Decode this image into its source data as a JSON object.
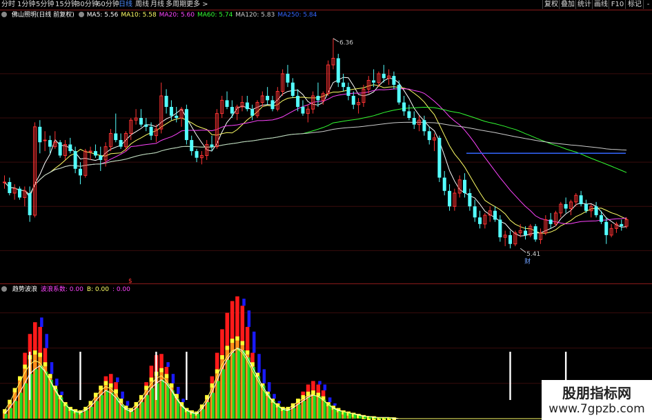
{
  "toolbar": {
    "periods": [
      {
        "label": "分时",
        "active": false
      },
      {
        "label": "1分钟",
        "active": false
      },
      {
        "label": "5分钟",
        "active": false
      },
      {
        "label": "15分钟",
        "active": false
      },
      {
        "label": "30分钟",
        "active": false
      },
      {
        "label": "60分钟",
        "active": false
      },
      {
        "label": "日线",
        "active": true
      },
      {
        "label": "周线",
        "active": false
      },
      {
        "label": "月线",
        "active": false
      },
      {
        "label": "多周期",
        "active": false
      },
      {
        "label": "更多 >",
        "active": false
      }
    ],
    "right_buttons": [
      "复权",
      "叠加",
      "统计",
      "画线",
      "F10",
      "标记",
      "-"
    ]
  },
  "main_legend": {
    "title": "佛山照明(日线 前复权)",
    "items": [
      {
        "label": "MA5: 5.56",
        "color": "#ffffff"
      },
      {
        "label": "MA10: 5.58",
        "color": "#ffff66"
      },
      {
        "label": "MA20: 5.60",
        "color": "#ff44ff"
      },
      {
        "label": "MA60: 5.74",
        "color": "#33ff33"
      },
      {
        "label": "MA120: 5.83",
        "color": "#cccccc"
      },
      {
        "label": "MA250: 5.84",
        "color": "#3366ff"
      }
    ]
  },
  "indicator_legend": {
    "title": "趋势波浪",
    "items": [
      {
        "label": "波浪系数: 0.00",
        "color": "#ff44ff"
      },
      {
        "label": "B: 0.00",
        "color": "#ffff66"
      },
      {
        "label": ": 0.00",
        "color": "#ff44ff"
      }
    ]
  },
  "annotations": {
    "high_label": "6.36",
    "low_label": "5.41",
    "event_mark_main": "财",
    "event_mark_bottom": "$"
  },
  "watermark": {
    "title": "股朋指标网",
    "url": "www.7gpzb.com"
  },
  "colors": {
    "up": "#ff3333",
    "down": "#54ffff",
    "separator": "#8b1a1a",
    "grid": "#3a0c0c"
  },
  "chart_data": [
    {
      "type": "candlestick",
      "title": "佛山照明(日线 前复权)",
      "ylim": [
        5.27,
        6.44
      ],
      "annotations": [
        {
          "label": "6.36",
          "value": 6.36
        },
        {
          "label": "5.41",
          "value": 5.41
        }
      ],
      "candles": [
        [
          5.71,
          5.74,
          5.68,
          5.71
        ],
        [
          5.71,
          5.73,
          5.65,
          5.66
        ],
        [
          5.66,
          5.7,
          5.63,
          5.68
        ],
        [
          5.68,
          5.69,
          5.63,
          5.64
        ],
        [
          5.64,
          5.69,
          5.6,
          5.67
        ],
        [
          5.66,
          5.69,
          5.53,
          5.56
        ],
        [
          5.56,
          5.98,
          5.55,
          5.96
        ],
        [
          5.96,
          5.99,
          5.84,
          5.89
        ],
        [
          5.9,
          5.94,
          5.85,
          5.9
        ],
        [
          5.9,
          5.92,
          5.84,
          5.87
        ],
        [
          5.87,
          5.94,
          5.86,
          5.89
        ],
        [
          5.89,
          5.9,
          5.82,
          5.83
        ],
        [
          5.83,
          5.9,
          5.81,
          5.88
        ],
        [
          5.88,
          5.91,
          5.84,
          5.85
        ],
        [
          5.85,
          5.87,
          5.75,
          5.77
        ],
        [
          5.77,
          5.8,
          5.7,
          5.74
        ],
        [
          5.74,
          5.86,
          5.73,
          5.85
        ],
        [
          5.85,
          5.87,
          5.81,
          5.85
        ],
        [
          5.85,
          5.88,
          5.82,
          5.83
        ],
        [
          5.83,
          5.87,
          5.76,
          5.81
        ],
        [
          5.81,
          5.89,
          5.78,
          5.87
        ],
        [
          5.87,
          5.95,
          5.85,
          5.93
        ],
        [
          5.93,
          6.02,
          5.89,
          5.9
        ],
        [
          5.9,
          5.93,
          5.86,
          5.87
        ],
        [
          5.87,
          5.94,
          5.85,
          5.93
        ],
        [
          5.93,
          6.0,
          5.9,
          5.99
        ],
        [
          5.99,
          6.04,
          5.97,
          6.0
        ],
        [
          6.0,
          6.04,
          5.96,
          5.97
        ],
        [
          5.97,
          6.0,
          5.94,
          5.96
        ],
        [
          5.96,
          5.98,
          5.9,
          5.92
        ],
        [
          5.92,
          5.97,
          5.89,
          5.95
        ],
        [
          5.95,
          6.16,
          5.93,
          6.1
        ],
        [
          6.1,
          6.13,
          6.02,
          6.05
        ],
        [
          6.05,
          6.08,
          5.99,
          6.01
        ],
        [
          6.01,
          6.05,
          5.98,
          6.0
        ],
        [
          6.0,
          6.05,
          5.96,
          6.04
        ],
        [
          6.04,
          6.06,
          5.88,
          5.9
        ],
        [
          5.9,
          5.92,
          5.83,
          5.85
        ],
        [
          5.85,
          5.86,
          5.8,
          5.82
        ],
        [
          5.82,
          5.85,
          5.79,
          5.83
        ],
        [
          5.83,
          5.9,
          5.81,
          5.88
        ],
        [
          5.88,
          5.92,
          5.85,
          5.87
        ],
        [
          5.87,
          6.04,
          5.86,
          6.02
        ],
        [
          6.02,
          6.1,
          6.0,
          6.08
        ],
        [
          6.08,
          6.12,
          6.04,
          6.05
        ],
        [
          6.05,
          6.08,
          6.0,
          6.02
        ],
        [
          6.02,
          6.06,
          5.99,
          6.05
        ],
        [
          6.05,
          6.1,
          6.03,
          6.07
        ],
        [
          6.07,
          6.1,
          6.03,
          6.04
        ],
        [
          6.04,
          6.06,
          5.99,
          6.01
        ],
        [
          6.01,
          6.08,
          6.0,
          6.07
        ],
        [
          6.07,
          6.12,
          6.05,
          6.1
        ],
        [
          6.1,
          6.14,
          6.06,
          6.08
        ],
        [
          6.08,
          6.1,
          6.03,
          6.04
        ],
        [
          6.04,
          6.14,
          6.03,
          6.12
        ],
        [
          6.12,
          6.22,
          6.1,
          6.2
        ],
        [
          6.2,
          6.24,
          6.14,
          6.16
        ],
        [
          6.16,
          6.18,
          6.09,
          6.1
        ],
        [
          6.1,
          6.13,
          6.03,
          6.05
        ],
        [
          6.05,
          6.08,
          6.01,
          6.02
        ],
        [
          6.02,
          6.06,
          5.98,
          6.04
        ],
        [
          6.04,
          6.12,
          6.02,
          6.1
        ],
        [
          6.1,
          6.16,
          6.05,
          6.08
        ],
        [
          6.08,
          6.12,
          6.06,
          6.11
        ],
        [
          6.11,
          6.26,
          6.1,
          6.24
        ],
        [
          6.24,
          6.36,
          6.22,
          6.27
        ],
        [
          6.27,
          6.29,
          6.14,
          6.16
        ],
        [
          6.16,
          6.2,
          6.12,
          6.14
        ],
        [
          6.14,
          6.16,
          6.08,
          6.1
        ],
        [
          6.1,
          6.12,
          6.04,
          6.06
        ],
        [
          6.06,
          6.09,
          6.02,
          6.07
        ],
        [
          6.07,
          6.15,
          6.05,
          6.13
        ],
        [
          6.13,
          6.19,
          6.11,
          6.17
        ],
        [
          6.17,
          6.22,
          6.14,
          6.16
        ],
        [
          6.16,
          6.21,
          6.14,
          6.2
        ],
        [
          6.2,
          6.24,
          6.16,
          6.18
        ],
        [
          6.18,
          6.22,
          6.15,
          6.19
        ],
        [
          6.19,
          6.21,
          6.13,
          6.15
        ],
        [
          6.15,
          6.17,
          6.06,
          6.07
        ],
        [
          6.07,
          6.1,
          6.01,
          6.03
        ],
        [
          6.03,
          6.06,
          5.99,
          6.0
        ],
        [
          6.0,
          6.03,
          5.95,
          5.97
        ],
        [
          5.97,
          6.01,
          5.94,
          5.99
        ],
        [
          5.99,
          6.01,
          5.92,
          5.94
        ],
        [
          5.94,
          5.96,
          5.88,
          5.9
        ],
        [
          5.9,
          5.93,
          5.85,
          5.91
        ],
        [
          5.91,
          5.92,
          5.71,
          5.73
        ],
        [
          5.73,
          5.76,
          5.65,
          5.67
        ],
        [
          5.67,
          5.7,
          5.58,
          5.6
        ],
        [
          5.6,
          5.68,
          5.58,
          5.66
        ],
        [
          5.66,
          5.74,
          5.64,
          5.72
        ],
        [
          5.72,
          5.75,
          5.64,
          5.66
        ],
        [
          5.66,
          5.68,
          5.58,
          5.6
        ],
        [
          5.6,
          5.63,
          5.53,
          5.55
        ],
        [
          5.55,
          5.58,
          5.5,
          5.52
        ],
        [
          5.52,
          5.57,
          5.5,
          5.56
        ],
        [
          5.56,
          5.6,
          5.53,
          5.58
        ],
        [
          5.58,
          5.6,
          5.53,
          5.54
        ],
        [
          5.54,
          5.56,
          5.44,
          5.46
        ],
        [
          5.46,
          5.49,
          5.42,
          5.47
        ],
        [
          5.47,
          5.49,
          5.41,
          5.43
        ],
        [
          5.43,
          5.49,
          5.42,
          5.48
        ],
        [
          5.48,
          5.52,
          5.46,
          5.49
        ],
        [
          5.49,
          5.51,
          5.45,
          5.47
        ],
        [
          5.47,
          5.52,
          5.46,
          5.51
        ],
        [
          5.51,
          5.52,
          5.44,
          5.45
        ],
        [
          5.45,
          5.5,
          5.43,
          5.48
        ],
        [
          5.48,
          5.56,
          5.47,
          5.54
        ],
        [
          5.54,
          5.57,
          5.5,
          5.52
        ],
        [
          5.52,
          5.58,
          5.51,
          5.57
        ],
        [
          5.57,
          5.62,
          5.55,
          5.61
        ],
        [
          5.61,
          5.64,
          5.57,
          5.59
        ],
        [
          5.59,
          5.63,
          5.56,
          5.62
        ],
        [
          5.62,
          5.66,
          5.6,
          5.65
        ],
        [
          5.65,
          5.67,
          5.6,
          5.61
        ],
        [
          5.61,
          5.63,
          5.57,
          5.58
        ],
        [
          5.58,
          5.61,
          5.55,
          5.6
        ],
        [
          5.6,
          5.62,
          5.55,
          5.56
        ],
        [
          5.56,
          5.58,
          5.52,
          5.53
        ],
        [
          5.53,
          5.55,
          5.43,
          5.47
        ],
        [
          5.47,
          5.52,
          5.46,
          5.5
        ],
        [
          5.5,
          5.53,
          5.48,
          5.52
        ],
        [
          5.52,
          5.54,
          5.49,
          5.51
        ],
        [
          5.51,
          5.55,
          5.5,
          5.54
        ]
      ]
    },
    {
      "type": "bar",
      "title": "趋势波浪",
      "ylim": [
        0,
        105
      ],
      "green": [
        4,
        9,
        15,
        22,
        30,
        38,
        42,
        45,
        40,
        33,
        25,
        18,
        12,
        8,
        6,
        5,
        7,
        10,
        15,
        20,
        24,
        22,
        18,
        12,
        8,
        6,
        9,
        14,
        20,
        26,
        30,
        33,
        30,
        24,
        17,
        11,
        7,
        5,
        4,
        8,
        14,
        22,
        32,
        42,
        50,
        56,
        60,
        58,
        52,
        44,
        36,
        28,
        21,
        15,
        11,
        8,
        7,
        9,
        12,
        15,
        18,
        20,
        19,
        16,
        12,
        9,
        7,
        6,
        5,
        4,
        3,
        2,
        2,
        1,
        1,
        1,
        1,
        0,
        0,
        0,
        0,
        0,
        0,
        0,
        0,
        0,
        0,
        0,
        0,
        0,
        0,
        0,
        0,
        0,
        0,
        0,
        0,
        0,
        0,
        0,
        0,
        0,
        0,
        0,
        0,
        0,
        0,
        0,
        0,
        0,
        0,
        0,
        0,
        0,
        0,
        0,
        0,
        0,
        0,
        0,
        0,
        0,
        0
      ],
      "orange": [
        8,
        16,
        26,
        36,
        46,
        54,
        58,
        56,
        48,
        38,
        28,
        20,
        14,
        10,
        8,
        7,
        10,
        15,
        22,
        28,
        32,
        30,
        25,
        17,
        11,
        9,
        14,
        20,
        28,
        35,
        40,
        43,
        38,
        30,
        21,
        14,
        9,
        7,
        6,
        12,
        20,
        30,
        42,
        54,
        62,
        68,
        70,
        66,
        58,
        48,
        39,
        30,
        23,
        17,
        13,
        10,
        10,
        13,
        17,
        20,
        23,
        24,
        22,
        19,
        14,
        11,
        9,
        7,
        6,
        5,
        4,
        3,
        2,
        2,
        1,
        1,
        1,
        1,
        0,
        0,
        0,
        0,
        0,
        0,
        0,
        0,
        0,
        0,
        0,
        0,
        0,
        0,
        0,
        0,
        0,
        0,
        0,
        0,
        0,
        0,
        0,
        0,
        0,
        0,
        0,
        0,
        0,
        0,
        0,
        0,
        0,
        0,
        0,
        0,
        0,
        0,
        0,
        0,
        0,
        0,
        0,
        0,
        0
      ],
      "red": [
        0,
        0,
        0,
        0,
        10,
        18,
        24,
        22,
        12,
        0,
        0,
        0,
        0,
        0,
        0,
        0,
        0,
        0,
        0,
        0,
        4,
        8,
        6,
        0,
        0,
        0,
        0,
        0,
        3,
        10,
        14,
        12,
        6,
        0,
        0,
        0,
        0,
        0,
        0,
        0,
        0,
        6,
        14,
        22,
        28,
        32,
        34,
        30,
        20,
        8,
        0,
        0,
        0,
        0,
        0,
        0,
        0,
        0,
        0,
        3,
        6,
        8,
        7,
        5,
        0,
        0,
        0,
        0,
        0,
        0,
        0,
        0,
        0,
        0,
        0,
        0,
        0,
        0,
        0,
        0,
        0,
        0,
        0,
        0,
        0,
        0,
        0,
        0,
        0,
        0,
        0,
        0,
        0,
        0,
        0,
        0,
        0,
        0,
        0,
        0,
        0,
        0,
        0,
        0,
        0,
        0,
        0,
        0,
        0,
        0,
        0,
        0,
        0,
        0,
        0,
        0,
        0,
        0,
        0,
        0,
        0,
        0,
        0
      ],
      "blue": [
        0,
        0,
        0,
        0,
        0,
        0,
        0,
        8,
        12,
        10,
        6,
        3,
        0,
        0,
        0,
        0,
        0,
        0,
        0,
        0,
        0,
        0,
        4,
        6,
        4,
        0,
        0,
        0,
        0,
        0,
        0,
        0,
        4,
        8,
        6,
        3,
        0,
        0,
        0,
        0,
        0,
        0,
        0,
        0,
        0,
        0,
        0,
        6,
        14,
        18,
        16,
        12,
        8,
        4,
        2,
        0,
        0,
        0,
        0,
        0,
        0,
        0,
        3,
        5,
        4,
        2,
        0,
        0,
        0,
        0,
        0,
        0,
        0,
        0,
        0,
        0,
        0,
        0,
        0,
        0,
        0,
        0,
        0,
        0,
        0,
        0,
        0,
        0,
        0,
        0,
        0,
        0,
        0,
        0,
        0,
        0,
        0,
        0,
        0,
        0,
        0,
        0,
        0,
        0,
        0,
        0,
        0,
        0,
        0,
        0,
        0,
        0,
        0,
        0,
        0,
        0,
        0,
        0,
        0,
        0,
        0,
        0,
        0
      ],
      "signals": [
        5,
        15,
        30,
        36,
        100,
        111
      ]
    }
  ]
}
